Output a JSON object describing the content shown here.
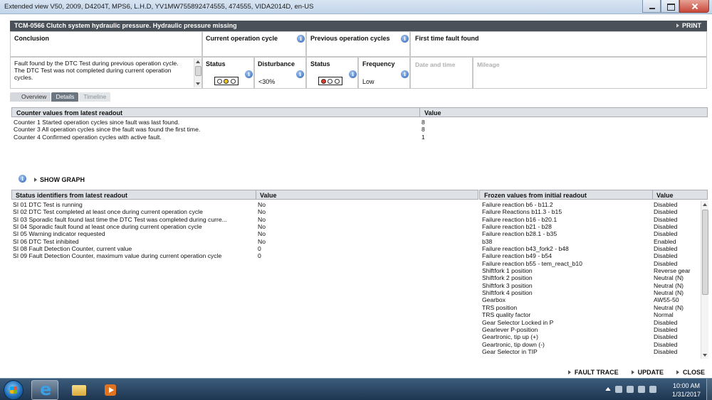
{
  "window": {
    "title": "Extended view  V50, 2009, D4204T, MPS6, L.H.D, YV1MW755892474555, 474555, VIDA2014D, en-US"
  },
  "header": {
    "title": "TCM-0566 Clutch system hydraulic pressure. Hydraulic pressure missing",
    "print_label": "PRINT"
  },
  "summary": {
    "conclusion_title": "Conclusion",
    "conclusion_text": "Fault found by the DTC Test during previous operation cycle.\nThe DTC Test was not completed during current operation cycles.",
    "current_cycle": {
      "title": "Current operation cycle",
      "status_label": "Status",
      "disturbance_label": "Disturbance",
      "disturbance_value": "<30%",
      "lamps": [
        "#ffffff",
        "#f0c419",
        "#ffffff"
      ]
    },
    "previous_cycles": {
      "title": "Previous operation cycles",
      "status_label": "Status",
      "frequency_label": "Frequency",
      "frequency_value": "Low",
      "lamps": [
        "#e23a2a",
        "#ffffff",
        "#ffffff"
      ]
    },
    "first_time": {
      "title": "First time fault found",
      "date_label": "Date and time",
      "mileage_label": "Mileage"
    }
  },
  "tabs": [
    {
      "label": "Overview"
    },
    {
      "label": "Details"
    },
    {
      "label": "Timeline"
    }
  ],
  "counters": {
    "col1": "Counter values from latest readout",
    "col2": "Value",
    "rows": [
      {
        "label": "Counter 1 Started operation cycles since fault was last found.",
        "value": "8"
      },
      {
        "label": "Counter 3 All operation cycles since the fault was found the first time.",
        "value": "8"
      },
      {
        "label": "Counter 4 Confirmed operation cycles with active fault.",
        "value": "1"
      }
    ]
  },
  "show_graph_label": "SHOW GRAPH",
  "status_ids": {
    "col1": "Status identifiers from latest readout",
    "col2": "Value",
    "rows": [
      {
        "label": "SI 01 DTC Test is running",
        "value": "No"
      },
      {
        "label": "SI 02 DTC Test completed at least once during current operation cycle",
        "value": "No"
      },
      {
        "label": "SI 03 Sporadic fault found last time the DTC Test was completed during curre...",
        "value": "No"
      },
      {
        "label": "SI 04 Sporadic fault found at least once during current operation cycle",
        "value": "No"
      },
      {
        "label": "SI 05 Warning indicator requested",
        "value": "No"
      },
      {
        "label": "SI 06 DTC Test inhibited",
        "value": "No"
      },
      {
        "label": "SI 08 Fault Detection Counter, current value",
        "value": "0"
      },
      {
        "label": "SI 09 Fault Detection Counter, maximum value during current operation cycle",
        "value": "0"
      }
    ]
  },
  "frozen": {
    "col1": "Frozen values from initial readout",
    "col2": "Value",
    "rows": [
      {
        "label": "Failure reaction b6 - b11.2",
        "value": "Disabled"
      },
      {
        "label": "Failure Reactions b11.3 - b15",
        "value": "Disabled"
      },
      {
        "label": "Failure reaction b16 - b20.1",
        "value": "Disabled"
      },
      {
        "label": "Failure reaction b21 - b28",
        "value": "Disabled"
      },
      {
        "label": "Failure reaction b28.1 - b35",
        "value": "Disabled"
      },
      {
        "label": "b38",
        "value": "Enabled"
      },
      {
        "label": "Failure reaction b43_fork2 - b48",
        "value": "Disabled"
      },
      {
        "label": "Failure reaction b49 - b54",
        "value": "Disabled"
      },
      {
        "label": "Failure reaction b55 - tem_react_b10",
        "value": "Disabled"
      },
      {
        "label": "Shiftfork 1 position",
        "value": "Reverse gear"
      },
      {
        "label": "Shiftfork 2 position",
        "value": "Neutral (N)"
      },
      {
        "label": "Shiftfork 3 position",
        "value": "Neutral (N)"
      },
      {
        "label": "Shiftfork 4 position",
        "value": "Neutral (N)"
      },
      {
        "label": "Gearbox",
        "value": "AW55-50"
      },
      {
        "label": "TRS position",
        "value": "Neutral (N)"
      },
      {
        "label": "TRS quality factor",
        "value": "Normal"
      },
      {
        "label": "Gear Selector Locked in P",
        "value": "Disabled"
      },
      {
        "label": "Gearlever P-position",
        "value": "Disabled"
      },
      {
        "label": "Geartronic, tip up (+)",
        "value": "Disabled"
      },
      {
        "label": "Geartronic, tip down (-)",
        "value": "Disabled"
      },
      {
        "label": "Gear Selector in TIP",
        "value": "Disabled"
      }
    ]
  },
  "bottom_links": {
    "fault_trace": "FAULT TRACE",
    "update": "UPDATE",
    "close": "CLOSE"
  },
  "taskbar": {
    "time": "10:00 AM",
    "date": "1/31/2017"
  }
}
